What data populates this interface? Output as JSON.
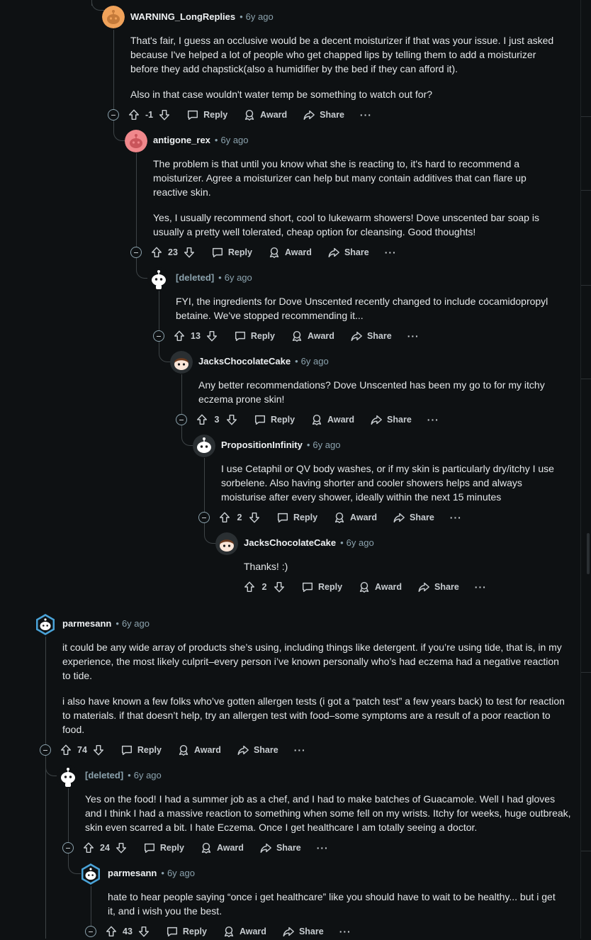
{
  "comments": [
    {
      "id": "c1",
      "username": "WARNING_LongReplies",
      "deleted": false,
      "avatar": "orange-snoo",
      "time": "6y ago",
      "score": "-1",
      "paragraphs": [
        "That's fair, I guess an occlusive would be a decent moisturizer if that was your issue. I just asked because I've helped a lot of people who get chapped lips by telling them to add a moisturizer before they add chapstick(also a humidifier by the bed if they can afford it).",
        "Also in that case wouldn't water temp be something to watch out for?"
      ]
    },
    {
      "id": "c2",
      "username": "antigone_rex",
      "deleted": false,
      "avatar": "pink-snoo",
      "time": "6y ago",
      "score": "23",
      "paragraphs": [
        "The problem is that until you know what she is reacting to, it's hard to recommend a moisturizer. Agree a moisturizer can help but many contain additives that can flare up reactive skin.",
        "Yes, I usually recommend short, cool to lukewarm showers! Dove unscented bar soap is usually a pretty well tolerated, cheap option for cleansing. Good thoughts!"
      ]
    },
    {
      "id": "c3",
      "username": "[deleted]",
      "deleted": true,
      "avatar": "white-snoo",
      "time": "6y ago",
      "score": "13",
      "paragraphs": [
        "FYI, the ingredients for Dove Unscented recently changed to include cocamidopropyl betaine. We've stopped recommending it..."
      ]
    },
    {
      "id": "c4",
      "username": "JacksChocolateCake",
      "deleted": false,
      "avatar": "brown-hair-snoo",
      "time": "6y ago",
      "score": "3",
      "paragraphs": [
        "Any better recommendations? Dove Unscented has been my go to for my itchy eczema prone skin!"
      ]
    },
    {
      "id": "c5",
      "username": "PropositionInfinity",
      "deleted": false,
      "avatar": "white-snoo",
      "time": "6y ago",
      "score": "2",
      "paragraphs": [
        "I use Cetaphil or QV body washes, or if my skin is particularly dry/itchy I use sorbelene. Also having shorter and cooler showers helps and always moisturise after every shower, ideally within the next 15 minutes"
      ]
    },
    {
      "id": "c6",
      "username": "JacksChocolateCake",
      "deleted": false,
      "avatar": "brown-hair-snoo",
      "time": "6y ago",
      "score": "2",
      "paragraphs": [
        "Thanks! :)"
      ]
    },
    {
      "id": "c7",
      "username": "parmesann",
      "deleted": false,
      "avatar": "blue-hex-snoo",
      "time": "6y ago",
      "score": "74",
      "paragraphs": [
        "it could be any wide array of products she’s using, including things like detergent. if you’re using tide, that is, in my experience, the most likely culprit–every person i’ve known personally who’s had eczema had a negative reaction to tide.",
        "i also have known a few folks who’ve gotten allergen tests (i got a “patch test” a few years back) to test for reaction to materials. if that doesn’t help, try an allergen test with food–some symptoms are a result of a poor reaction to food."
      ]
    },
    {
      "id": "c8",
      "username": "[deleted]",
      "deleted": true,
      "avatar": "white-snoo",
      "time": "6y ago",
      "score": "24",
      "paragraphs": [
        "Yes on the food! I had a summer job as a chef, and I had to make batches of Guacamole. Well I had gloves and I think I had a massive reaction to something when some fell on my wrists. Itchy for weeks, huge outbreak, skin even scarred a bit. I hate Eczema. Once I get healthcare I am totally seeing a doctor."
      ]
    },
    {
      "id": "c9",
      "username": "parmesann",
      "deleted": false,
      "avatar": "blue-hex-snoo",
      "time": "6y ago",
      "score": "43",
      "paragraphs": [
        "hate to hear people saying “once i get healthcare” like you should have to wait to be healthy... but i get it, and i wish you the best."
      ]
    }
  ],
  "labels": {
    "reply": "Reply",
    "award": "Award",
    "share": "Share",
    "more": "···",
    "separator": "•"
  },
  "icons": {
    "upvote": "upvote-arrow-icon",
    "downvote": "downvote-arrow-icon",
    "reply": "speech-bubble-icon",
    "award": "award-ribbon-icon",
    "share": "share-arrow-icon",
    "collapse": "collapse-minus-icon"
  },
  "colors": {
    "background": "#0e1113",
    "text": "#e3e6e8",
    "meta": "#8ba2ad",
    "thread_line": "#3e4447"
  }
}
